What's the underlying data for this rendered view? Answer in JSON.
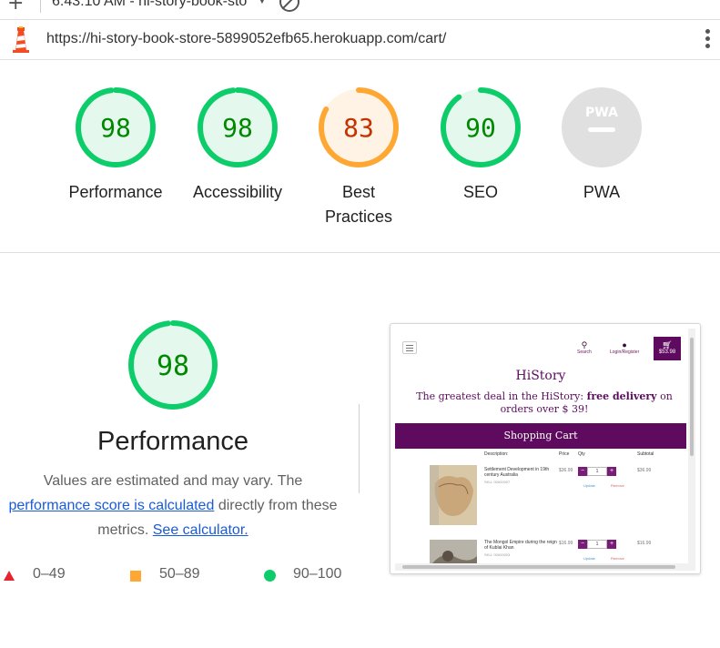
{
  "toolbar": {
    "new_icon": "plus-icon",
    "report_title": "6:43:10 AM - hi-story-book-sto",
    "dropdown_icon": "caret-down-icon",
    "clear_icon": "block-icon"
  },
  "urlbar": {
    "icon": "lighthouse-icon",
    "url": "https://hi-story-book-store-5899052efb65.herokuapp.com/cart/",
    "menu_icon": "kebab-menu-icon"
  },
  "gauges": [
    {
      "label": "Performance",
      "score": "98",
      "value": 98,
      "status": "pass"
    },
    {
      "label": "Accessibility",
      "score": "98",
      "value": 98,
      "status": "pass"
    },
    {
      "label": "Best Practices",
      "label_line1": "Best",
      "label_line2": "Practices",
      "score": "83",
      "value": 83,
      "status": "average"
    },
    {
      "label": "SEO",
      "score": "90",
      "value": 90,
      "status": "pass"
    },
    {
      "label": "PWA",
      "score": "",
      "badge": "PWA",
      "status": "na"
    }
  ],
  "colors": {
    "pass": "#0ccd6a",
    "pass_text": "#008800",
    "pass_bg": "#e5f8ee",
    "average": "#ffa733",
    "average_text": "#c33300",
    "average_bg": "#fff3e5",
    "fail": "#e8222e",
    "na_bg": "#e0e0e0"
  },
  "performance": {
    "score": "98",
    "value": 98,
    "title": "Performance",
    "desc_part1": "Values are estimated and may vary. The",
    "desc_link": "performance score is calculated",
    "desc_part2": "directly from these metrics.",
    "calc_link": "See calculator."
  },
  "legend": [
    {
      "range": "0–49",
      "marker": "triangle-icon"
    },
    {
      "range": "50–89",
      "marker": "square-icon"
    },
    {
      "range": "90–100",
      "marker": "circle-icon"
    }
  ],
  "thumbnail": {
    "search_label": "Search",
    "login_label": "Login/Register",
    "cart_total": "$53.98",
    "brand": "HiStory",
    "promo_part1": "The greatest deal in the HiStory:",
    "promo_bold": "free delivery",
    "promo_part2": "on orders over $ 39!",
    "banner": "Shopping Cart",
    "col_description": "Description:",
    "col_price": "Price",
    "col_qty": "Qty",
    "col_subtotal": "Subtotal",
    "items": [
      {
        "title": "Settlement Development in 19th century Australia",
        "sku": "SKU: 00000007",
        "price": "$36.99",
        "qty": "1",
        "subtotal": "$36.99",
        "update": "Update",
        "remove": "Remove"
      },
      {
        "title": "The Mongol Empire during the reign of Kublai Khan",
        "sku": "SKU: 00000003",
        "price": "$16.99",
        "qty": "1",
        "subtotal": "$16.99",
        "update": "Update",
        "remove": "Remove"
      }
    ]
  }
}
